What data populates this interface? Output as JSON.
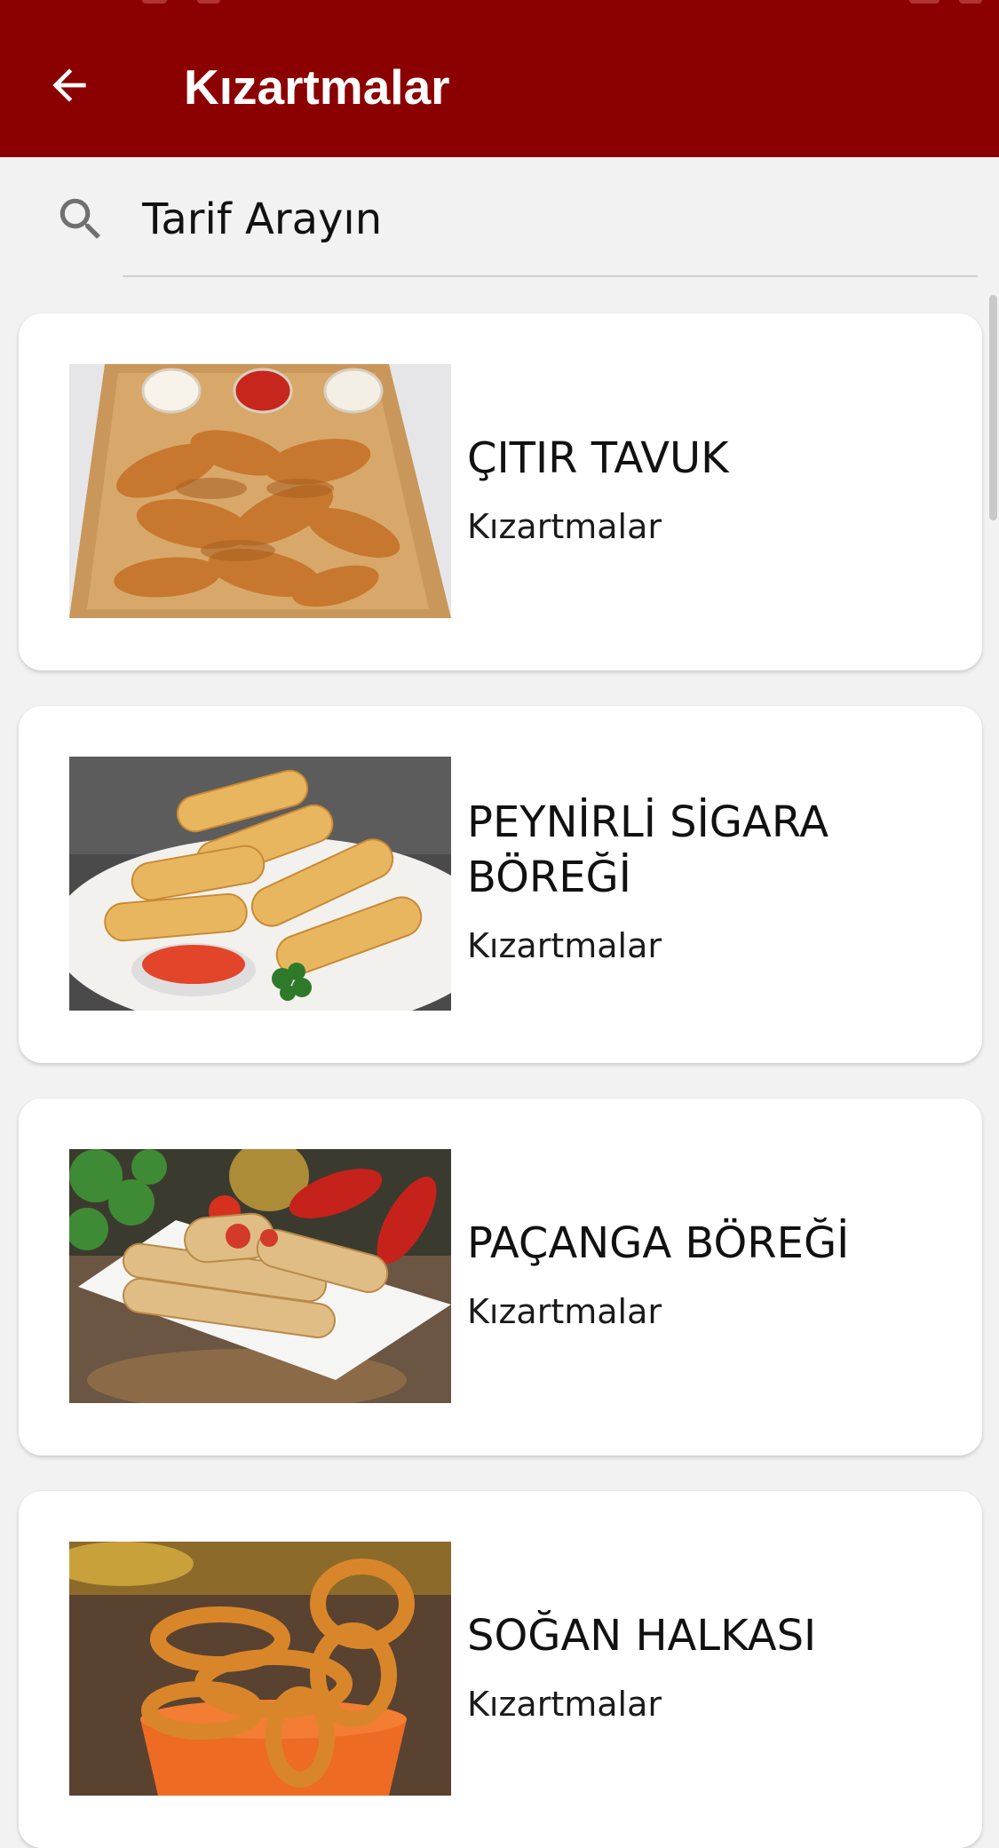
{
  "appbar": {
    "title": "Kızartmalar",
    "color": "#8b0000"
  },
  "search": {
    "placeholder": "Tarif Arayın",
    "value": ""
  },
  "recipes": [
    {
      "title": "ÇITIR TAVUK",
      "category": "Kızartmalar",
      "image": "crispy-chicken-photo"
    },
    {
      "title": "PEYNİRLİ SİGARA BÖREĞİ",
      "category": "Kızartmalar",
      "image": "cheese-cigar-borek-photo"
    },
    {
      "title": "PAÇANGA BÖREĞİ",
      "category": "Kızartmalar",
      "image": "pacanga-borek-photo"
    },
    {
      "title": "SOĞAN HALKASI",
      "category": "Kızartmalar",
      "image": "onion-rings-photo"
    }
  ]
}
